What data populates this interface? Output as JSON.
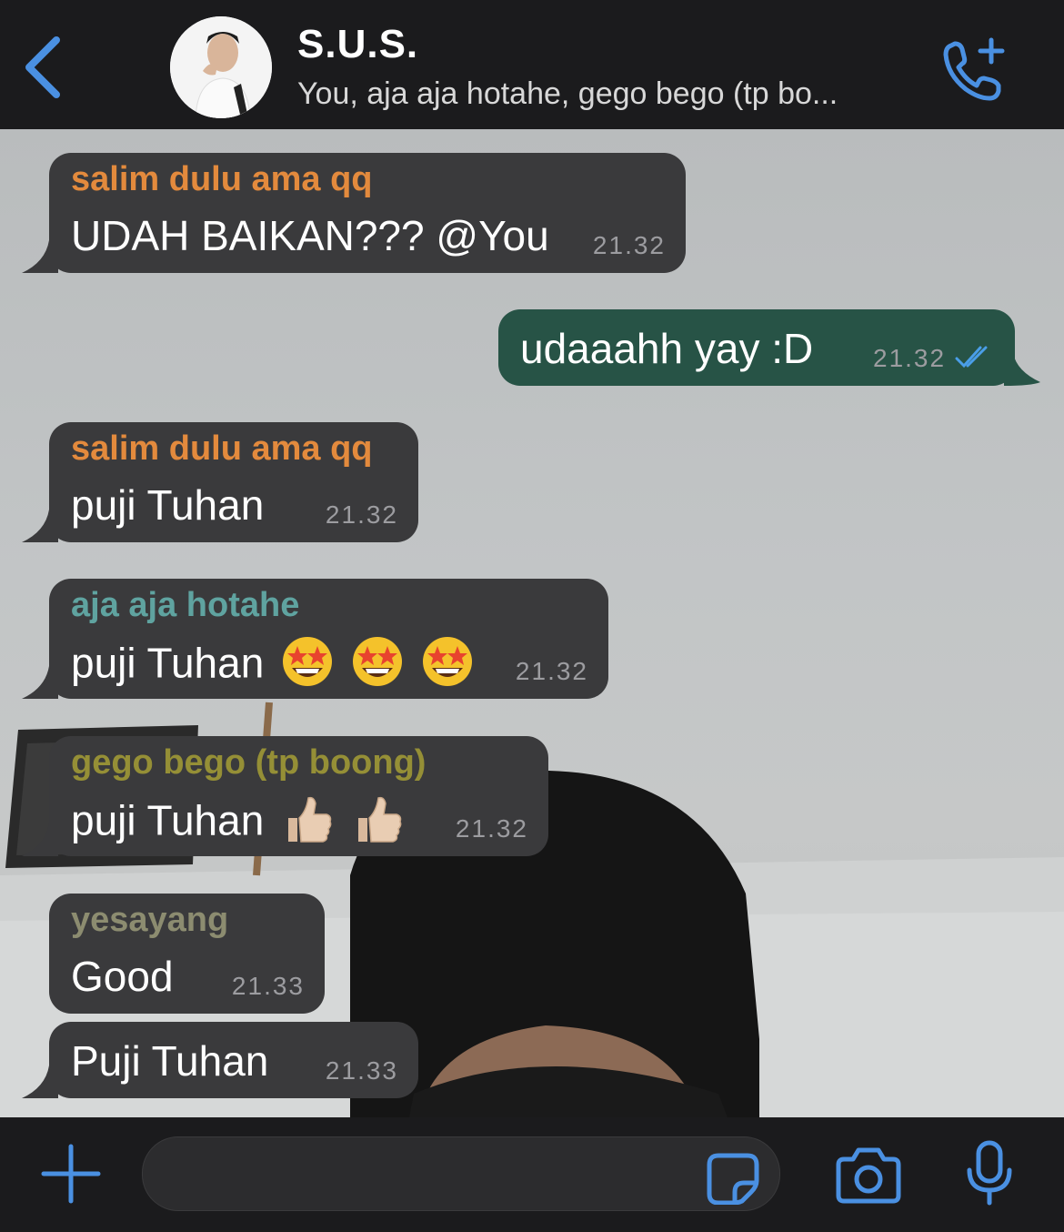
{
  "header": {
    "title": "S.U.S.",
    "subtitle": "You, aja aja hotahe, gego bego (tp bo..."
  },
  "messages": [
    {
      "sender": "salim dulu ama qq",
      "sender_color": "#e38a3d",
      "text": "UDAH BAIKAN??? @You",
      "time": "21.32"
    },
    {
      "outgoing": true,
      "text": "udaaahh yay :D",
      "time": "21.32",
      "status": "read"
    },
    {
      "sender": "salim dulu ama qq",
      "sender_color": "#e38a3d",
      "text": "puji Tuhan",
      "time": "21.32"
    },
    {
      "sender": "aja aja hotahe",
      "sender_color": "#5fa3a0",
      "text": "puji Tuhan",
      "emojis": [
        "star-struck-icon",
        "star-struck-icon",
        "star-struck-icon"
      ],
      "time": "21.32"
    },
    {
      "sender": "gego bego (tp boong)",
      "sender_color": "#958f36",
      "text": "puji Tuhan",
      "emojis": [
        "thumbs-up-icon",
        "thumbs-up-icon"
      ],
      "time": "21.32"
    },
    {
      "sender": "yesayang",
      "sender_color": "#8c8c70",
      "text": "Good",
      "time": "21.33"
    },
    {
      "text": "Puji Tuhan",
      "time": "21.33"
    }
  ],
  "icons": {
    "back": "chevron-left-icon",
    "call": "phone-plus-icon",
    "attach": "plus-icon",
    "sticker": "sticker-icon",
    "camera": "camera-icon",
    "mic": "microphone-icon"
  },
  "colors": {
    "accent": "#4a90e2",
    "incoming_bubble": "#3a3a3c",
    "outgoing_bubble": "#275346",
    "bar": "#1b1b1d"
  }
}
